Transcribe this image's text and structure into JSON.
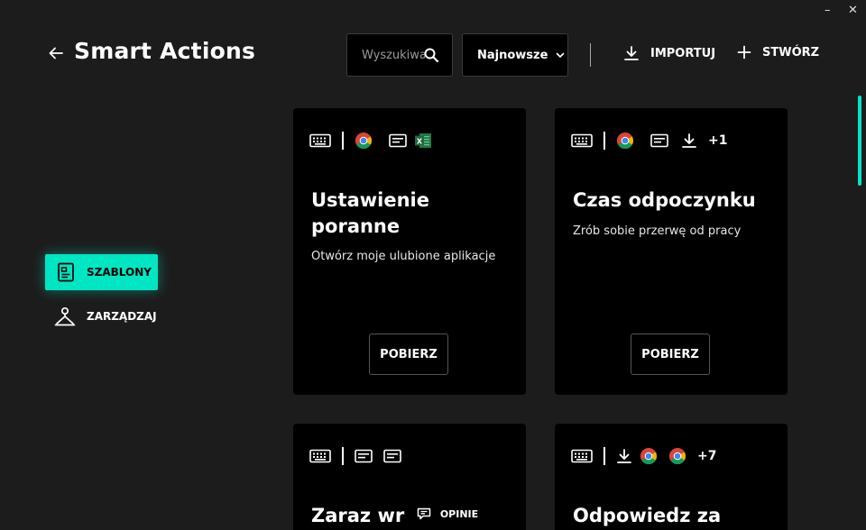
{
  "window": {
    "minimize": "–",
    "close": "✕"
  },
  "header": {
    "title": "Smart Actions"
  },
  "search": {
    "placeholder": "Wyszukiwanie"
  },
  "sort": {
    "label": "Najnowsze"
  },
  "toolbar": {
    "import_label": "IMPORTUJ",
    "create_label": "STWÓRZ"
  },
  "sidebar": {
    "items": [
      {
        "label": "SZABLONY",
        "active": true,
        "icon": "template-icon"
      },
      {
        "label": "ZARZĄDZAJ",
        "active": false,
        "icon": "manage-icon"
      }
    ]
  },
  "cards": [
    {
      "title": "Ustawienie poranne",
      "description": "Otwórz moje ulubione aplikacje",
      "button": "POBIERZ",
      "icons": [
        "keyboard-icon",
        "chrome-icon",
        "text-icon",
        "excel-icon"
      ]
    },
    {
      "title": "Czas odpoczynku",
      "description": "Zrób sobie przerwę od pracy",
      "button": "POBIERZ",
      "icons": [
        "keyboard-icon",
        "chrome-icon",
        "text-icon",
        "download-icon"
      ],
      "more": "+1"
    },
    {
      "title": "Zaraz wr",
      "icons": [
        "keyboard-icon",
        "text-icon",
        "text-icon"
      ]
    },
    {
      "title": "Odpowiedz za",
      "icons": [
        "keyboard-icon",
        "download-icon",
        "chrome-icon",
        "chrome-icon"
      ],
      "more": "+7"
    }
  ],
  "feedback": {
    "label": "OPINIE"
  },
  "colors": {
    "accent": "#00e6c3",
    "background": "#1c1c1c",
    "card": "#000000"
  }
}
